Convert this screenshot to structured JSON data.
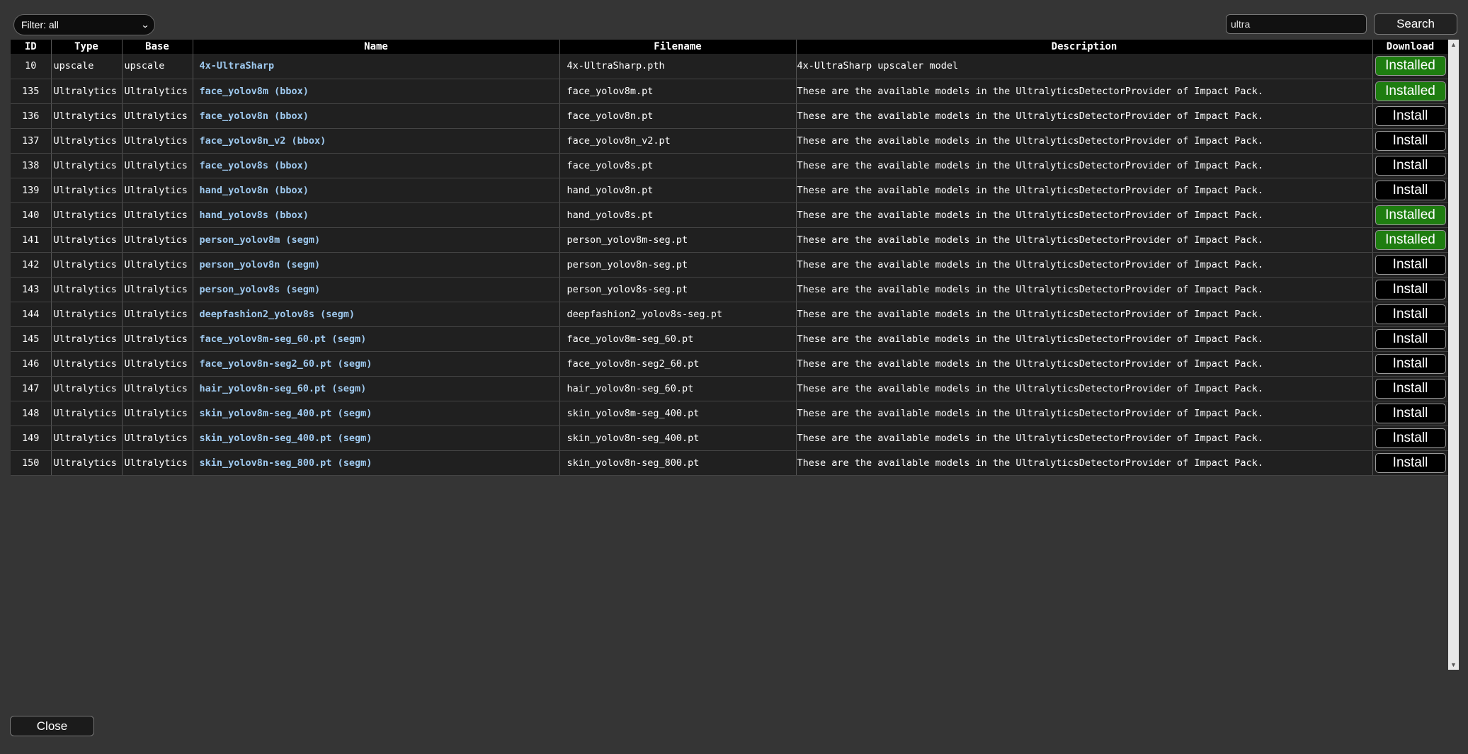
{
  "filter": {
    "selected": "Filter: all"
  },
  "search": {
    "value": "ultra",
    "button_label": "Search"
  },
  "table": {
    "headers": [
      "ID",
      "Type",
      "Base",
      "Name",
      "Filename",
      "Description",
      "Download"
    ],
    "rows": [
      {
        "id": "10",
        "type": "upscale",
        "base": "upscale",
        "name": "4x-UltraSharp",
        "filename": "4x-UltraSharp.pth",
        "description": "4x-UltraSharp upscaler model",
        "status": "Installed"
      },
      {
        "id": "135",
        "type": "Ultralytics",
        "base": "Ultralytics",
        "name": "face_yolov8m (bbox)",
        "filename": "face_yolov8m.pt",
        "description": "These are the available models in the UltralyticsDetectorProvider of Impact Pack.",
        "status": "Installed"
      },
      {
        "id": "136",
        "type": "Ultralytics",
        "base": "Ultralytics",
        "name": "face_yolov8n (bbox)",
        "filename": "face_yolov8n.pt",
        "description": "These are the available models in the UltralyticsDetectorProvider of Impact Pack.",
        "status": "Install"
      },
      {
        "id": "137",
        "type": "Ultralytics",
        "base": "Ultralytics",
        "name": "face_yolov8n_v2 (bbox)",
        "filename": "face_yolov8n_v2.pt",
        "description": "These are the available models in the UltralyticsDetectorProvider of Impact Pack.",
        "status": "Install"
      },
      {
        "id": "138",
        "type": "Ultralytics",
        "base": "Ultralytics",
        "name": "face_yolov8s (bbox)",
        "filename": "face_yolov8s.pt",
        "description": "These are the available models in the UltralyticsDetectorProvider of Impact Pack.",
        "status": "Install"
      },
      {
        "id": "139",
        "type": "Ultralytics",
        "base": "Ultralytics",
        "name": "hand_yolov8n (bbox)",
        "filename": "hand_yolov8n.pt",
        "description": "These are the available models in the UltralyticsDetectorProvider of Impact Pack.",
        "status": "Install"
      },
      {
        "id": "140",
        "type": "Ultralytics",
        "base": "Ultralytics",
        "name": "hand_yolov8s (bbox)",
        "filename": "hand_yolov8s.pt",
        "description": "These are the available models in the UltralyticsDetectorProvider of Impact Pack.",
        "status": "Installed"
      },
      {
        "id": "141",
        "type": "Ultralytics",
        "base": "Ultralytics",
        "name": "person_yolov8m (segm)",
        "filename": "person_yolov8m-seg.pt",
        "description": "These are the available models in the UltralyticsDetectorProvider of Impact Pack.",
        "status": "Installed"
      },
      {
        "id": "142",
        "type": "Ultralytics",
        "base": "Ultralytics",
        "name": "person_yolov8n (segm)",
        "filename": "person_yolov8n-seg.pt",
        "description": "These are the available models in the UltralyticsDetectorProvider of Impact Pack.",
        "status": "Install"
      },
      {
        "id": "143",
        "type": "Ultralytics",
        "base": "Ultralytics",
        "name": "person_yolov8s (segm)",
        "filename": "person_yolov8s-seg.pt",
        "description": "These are the available models in the UltralyticsDetectorProvider of Impact Pack.",
        "status": "Install"
      },
      {
        "id": "144",
        "type": "Ultralytics",
        "base": "Ultralytics",
        "name": "deepfashion2_yolov8s (segm)",
        "filename": "deepfashion2_yolov8s-seg.pt",
        "description": "These are the available models in the UltralyticsDetectorProvider of Impact Pack.",
        "status": "Install"
      },
      {
        "id": "145",
        "type": "Ultralytics",
        "base": "Ultralytics",
        "name": "face_yolov8m-seg_60.pt (segm)",
        "filename": "face_yolov8m-seg_60.pt",
        "description": "These are the available models in the UltralyticsDetectorProvider of Impact Pack.",
        "status": "Install"
      },
      {
        "id": "146",
        "type": "Ultralytics",
        "base": "Ultralytics",
        "name": "face_yolov8n-seg2_60.pt (segm)",
        "filename": "face_yolov8n-seg2_60.pt",
        "description": "These are the available models in the UltralyticsDetectorProvider of Impact Pack.",
        "status": "Install"
      },
      {
        "id": "147",
        "type": "Ultralytics",
        "base": "Ultralytics",
        "name": "hair_yolov8n-seg_60.pt (segm)",
        "filename": "hair_yolov8n-seg_60.pt",
        "description": "These are the available models in the UltralyticsDetectorProvider of Impact Pack.",
        "status": "Install"
      },
      {
        "id": "148",
        "type": "Ultralytics",
        "base": "Ultralytics",
        "name": "skin_yolov8m-seg_400.pt (segm)",
        "filename": "skin_yolov8m-seg_400.pt",
        "description": "These are the available models in the UltralyticsDetectorProvider of Impact Pack.",
        "status": "Install"
      },
      {
        "id": "149",
        "type": "Ultralytics",
        "base": "Ultralytics",
        "name": "skin_yolov8n-seg_400.pt (segm)",
        "filename": "skin_yolov8n-seg_400.pt",
        "description": "These are the available models in the UltralyticsDetectorProvider of Impact Pack.",
        "status": "Install"
      },
      {
        "id": "150",
        "type": "Ultralytics",
        "base": "Ultralytics",
        "name": "skin_yolov8n-seg_800.pt (segm)",
        "filename": "skin_yolov8n-seg_800.pt",
        "description": "These are the available models in the UltralyticsDetectorProvider of Impact Pack.",
        "status": "Install"
      }
    ]
  },
  "footer": {
    "close_label": "Close"
  },
  "colors": {
    "background": "#353535",
    "installed_green": "#1e7d10",
    "link_blue": "#9fcaf0"
  },
  "icons": {
    "filter_chevron": "chevron-down-icon",
    "scroll_up": "scroll-up-arrow-icon",
    "scroll_down": "scroll-down-arrow-icon"
  }
}
